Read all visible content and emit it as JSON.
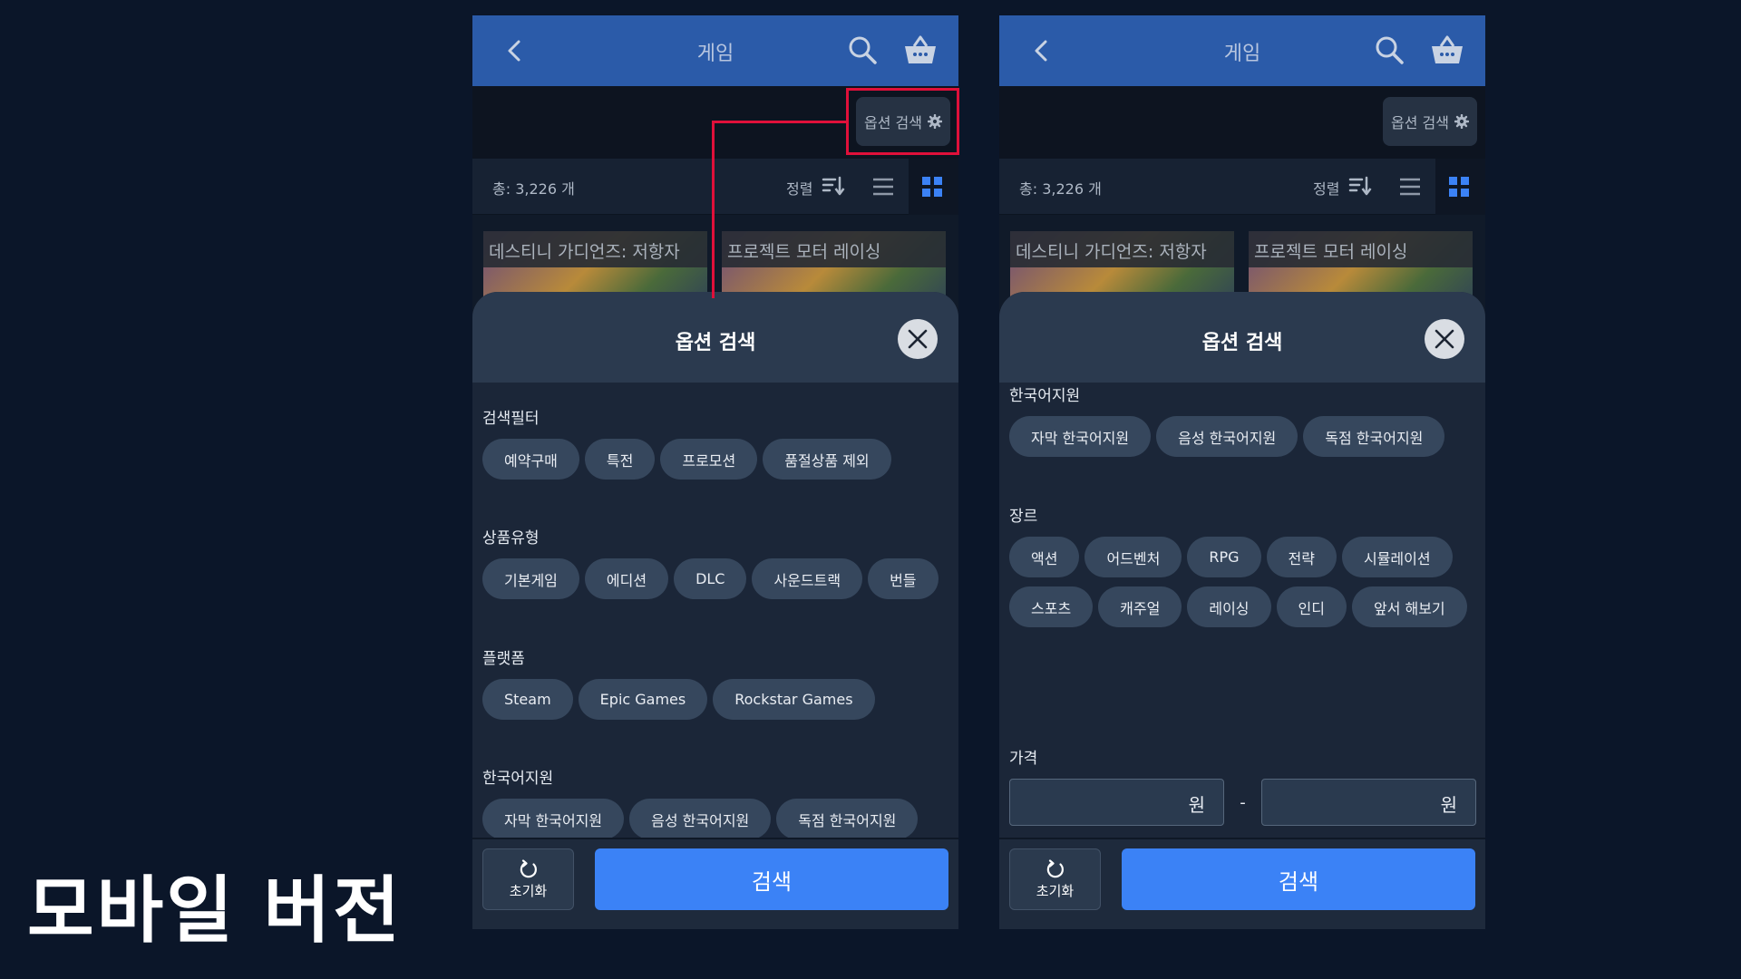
{
  "caption": "모바일 버전",
  "header": {
    "title": "게임"
  },
  "option_button": {
    "label": "옵션 검색"
  },
  "toolbar": {
    "count": "총: 3,226 개",
    "sort_label": "정렬"
  },
  "cards": [
    "데스티니 가디언즈: 저항자",
    "프로젝트 모터 레이싱"
  ],
  "sheet": {
    "title": "옵션 검색",
    "sections": {
      "filter": {
        "label": "검색필터",
        "chips": [
          "예약구매",
          "특전",
          "프로모션",
          "품절상품 제외"
        ]
      },
      "type": {
        "label": "상품유형",
        "chips": [
          "기본게임",
          "에디션",
          "DLC",
          "사운드트랙",
          "번들"
        ]
      },
      "platform": {
        "label": "플랫폼",
        "chips": [
          "Steam",
          "Epic Games",
          "Rockstar Games"
        ]
      },
      "korean": {
        "label": "한국어지원",
        "chips": [
          "자막 한국어지원",
          "음성 한국어지원",
          "독점 한국어지원"
        ]
      },
      "genre": {
        "label": "장르",
        "chips": [
          "액션",
          "어드벤처",
          "RPG",
          "전략",
          "시뮬레이션",
          "스포츠",
          "캐주얼",
          "레이싱",
          "인디",
          "앞서 해보기"
        ]
      },
      "price": {
        "label": "가격",
        "unit": "원",
        "separator": "-"
      }
    },
    "reset_label": "초기화",
    "search_label": "검색"
  },
  "colors": {
    "header": "#2b5ba9",
    "accent": "#3b82f6",
    "highlight": "#e0103a",
    "background": "#0b1629"
  },
  "icons": [
    "back-icon",
    "search-icon",
    "cart-icon",
    "gear-icon",
    "sort-icon",
    "list-view-icon",
    "grid-view-icon",
    "close-icon",
    "reset-icon"
  ]
}
